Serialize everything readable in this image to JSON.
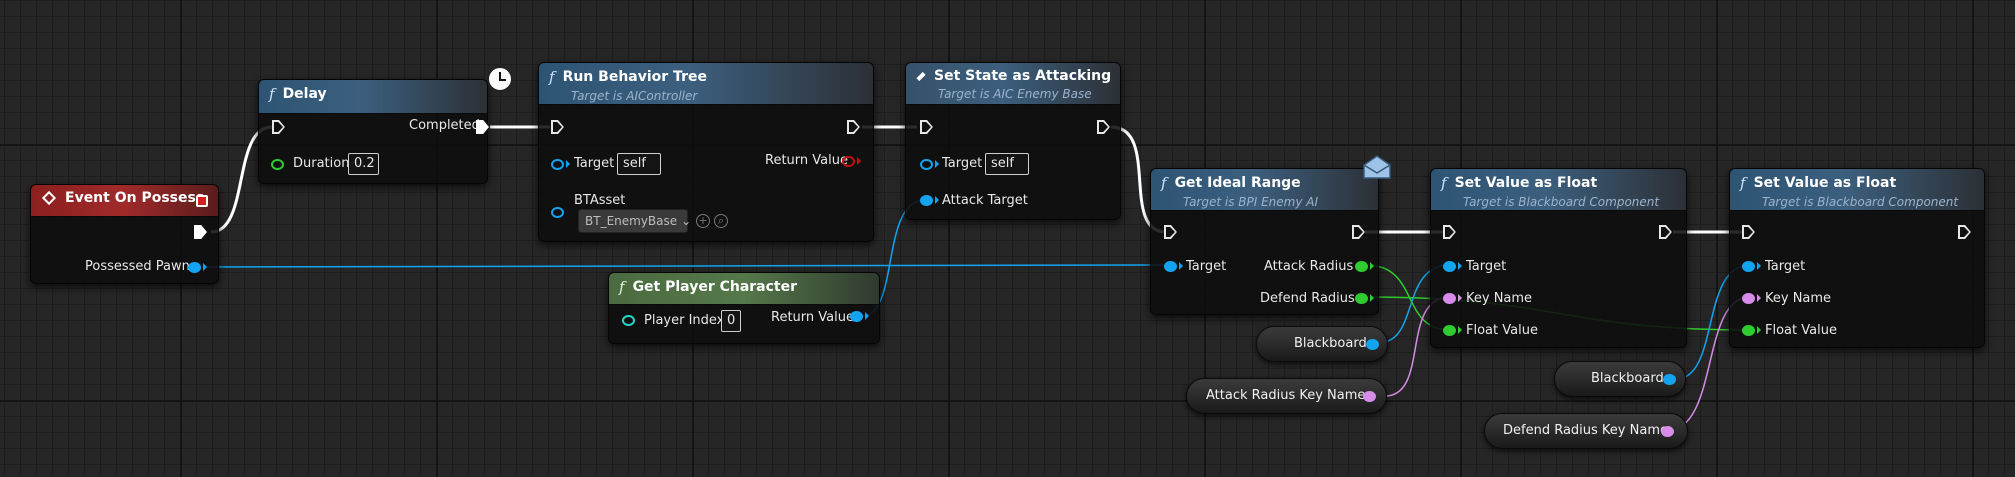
{
  "colors": {
    "exec_wire": "#ffffff",
    "object_pin": "#12a4f0",
    "float_pin": "#2fcc2f",
    "name_pin": "#d68ce8",
    "bool_pin": "#c01010",
    "function_header": "#3c5f7e",
    "pure_header": "#55784a",
    "event_header": "#a02a2a"
  },
  "nodes": {
    "event_on_possess": {
      "title": "Event On Possess",
      "out_pawn": "Possessed Pawn"
    },
    "delay": {
      "title": "Delay",
      "duration_label": "Duration",
      "duration_value": "0.2",
      "completed": "Completed",
      "icon": "clock-icon"
    },
    "run_behavior_tree": {
      "title": "Run Behavior Tree",
      "subtitle": "Target is AIController",
      "target_label": "Target",
      "target_value": "self",
      "return_label": "Return Value",
      "btasset_label": "BTAsset",
      "btasset_value": "BT_EnemyBase"
    },
    "set_state_attacking": {
      "title": "Set State as Attacking",
      "subtitle": "Target is AIC Enemy Base",
      "target_label": "Target",
      "target_value": "self",
      "attack_target_label": "Attack Target"
    },
    "get_player_character": {
      "title": "Get Player Character",
      "player_index_label": "Player Index",
      "player_index_value": "0",
      "return_label": "Return Value"
    },
    "get_ideal_range": {
      "title": "Get Ideal Range",
      "subtitle": "Target is BPI Enemy AI",
      "target_label": "Target",
      "attack_radius": "Attack Radius",
      "defend_radius": "Defend Radius",
      "icon": "envelope-icon"
    },
    "set_value_float_1": {
      "title": "Set Value as Float",
      "subtitle": "Target is Blackboard Component",
      "target_label": "Target",
      "key_name_label": "Key Name",
      "float_value_label": "Float Value"
    },
    "set_value_float_2": {
      "title": "Set Value as Float",
      "subtitle": "Target is Blackboard Component",
      "target_label": "Target",
      "key_name_label": "Key Name",
      "float_value_label": "Float Value"
    }
  },
  "variables": {
    "blackboard_1": "Blackboard",
    "attack_radius_key_name": "Attack Radius Key Name",
    "blackboard_2": "Blackboard",
    "defend_radius_key_name": "Defend Radius Key Name"
  }
}
